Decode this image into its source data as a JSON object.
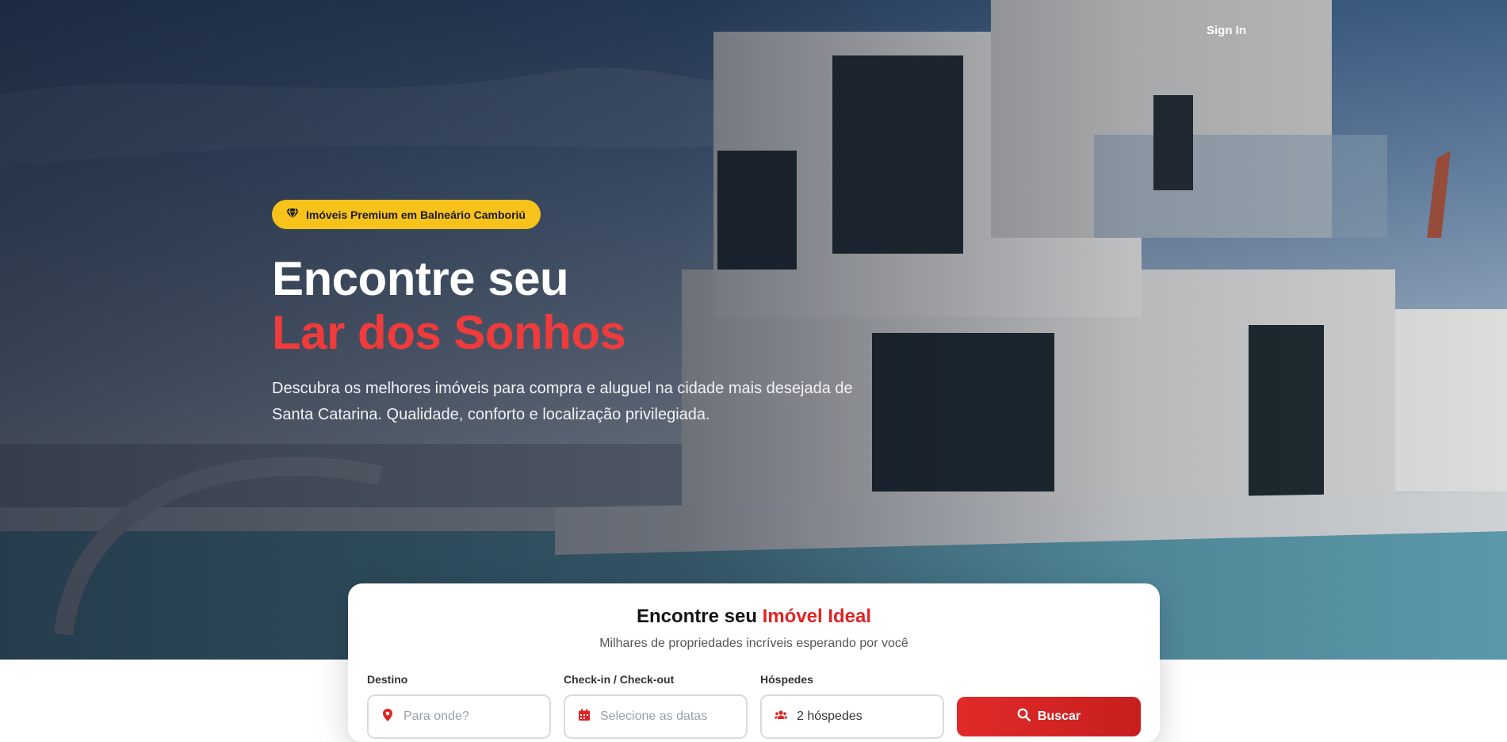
{
  "header": {
    "signin_label": "Sign In"
  },
  "hero": {
    "badge_label": "Imóveis Premium em Balneário Camboriú",
    "title_line1": "Encontre seu",
    "title_line2": "Lar dos Sonhos",
    "subtitle": "Descubra os melhores imóveis para compra e aluguel na cidade mais desejada de Santa Catarina. Qualidade, conforto e localização privilegiada."
  },
  "search": {
    "title_prefix": "Encontre seu",
    "title_accent": "Imóvel Ideal",
    "subtitle": "Milhares de propriedades incríveis esperando por você",
    "destino_label": "Destino",
    "destino_placeholder": "Para onde?",
    "dates_label": "Check-in / Check-out",
    "dates_placeholder": "Selecione as datas",
    "guests_label": "Hóspedes",
    "guests_value": "2 hóspedes",
    "button_label": "Buscar"
  },
  "colors": {
    "accent": "#e02424",
    "badge": "#f7c21a"
  },
  "icons": [
    "gem-icon",
    "map-marker-icon",
    "calendar-icon",
    "users-icon",
    "search-icon"
  ]
}
